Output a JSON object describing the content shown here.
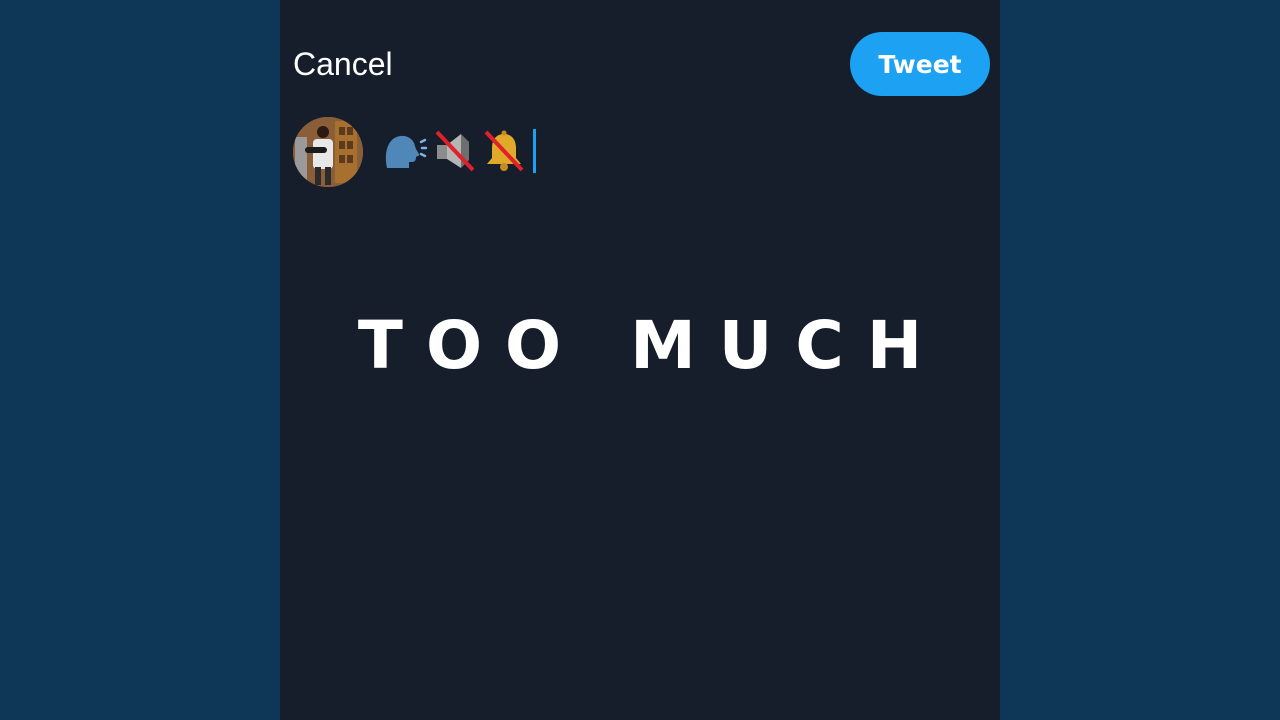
{
  "header": {
    "cancel_label": "Cancel",
    "tweet_label": "Tweet"
  },
  "compose": {
    "emojis": [
      "speaking-head-icon",
      "muted-speaker-icon",
      "bell-with-slash-icon"
    ]
  },
  "overlay": {
    "caption": "TOO MUCH"
  },
  "colors": {
    "background_side": "#0e3757",
    "panel": "#171e2b",
    "accent": "#1da1f2",
    "text": "#ffffff"
  }
}
